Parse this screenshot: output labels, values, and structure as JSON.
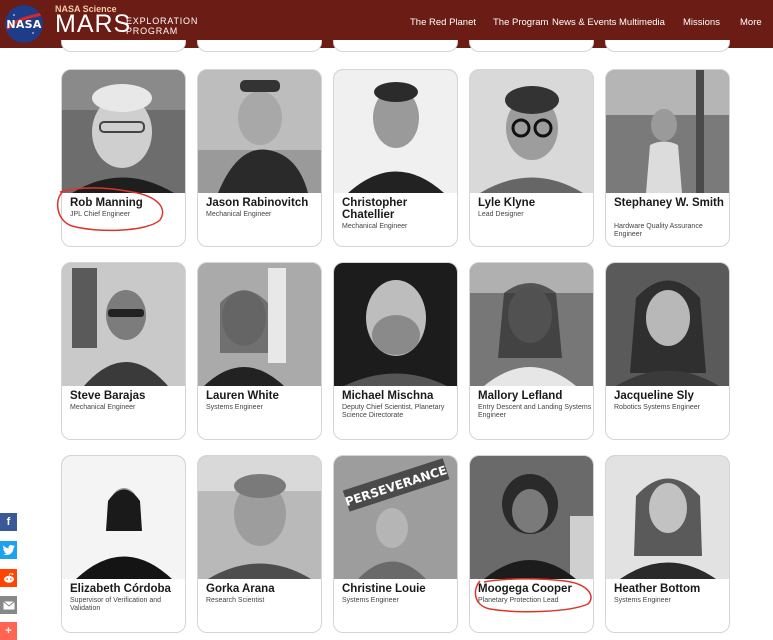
{
  "header": {
    "logo_text": "NASA",
    "kicker": "NASA Science",
    "title": "MARS",
    "subtitle_line1": "EXPLORATION",
    "subtitle_line2": "PROGRAM",
    "nav": [
      "The Red Planet",
      "The Program",
      "News & Events",
      "Multimedia",
      "Missions",
      "More"
    ]
  },
  "people": [
    {
      "name": "Rob Manning",
      "role": "JPL Chief Engineer"
    },
    {
      "name": "Jason Rabinovitch",
      "role": "Mechanical Engineer"
    },
    {
      "name": "Christopher Chatellier",
      "role": "Mechanical Engineer"
    },
    {
      "name": "Lyle Klyne",
      "role": "Lead Designer"
    },
    {
      "name": "Stephaney W. Smith",
      "role": "Hardware Quality Assurance Engineer"
    },
    {
      "name": "Steve Barajas",
      "role": "Mechanical Engineer"
    },
    {
      "name": "Lauren White",
      "role": "Systems Engineer"
    },
    {
      "name": "Michael Mischna",
      "role": "Deputy Chief Scientist, Planetary Science Directorate"
    },
    {
      "name": "Mallory Lefland",
      "role": "Entry Descent and Landing Systems Engineer"
    },
    {
      "name": "Jacqueline Sly",
      "role": "Robotics Systems Engineer"
    },
    {
      "name": "Elizabeth Córdoba",
      "role": "Supervisor of Verification and Validation"
    },
    {
      "name": "Gorka Arana",
      "role": "Research Scientist"
    },
    {
      "name": "Christine Louie",
      "role": "Systems Engineer"
    },
    {
      "name": "Moogega Cooper",
      "role": "Planetary Protection Lead"
    },
    {
      "name": "Heather Bottom",
      "role": "Systems Engineer"
    }
  ],
  "share": [
    {
      "icon": "facebook-icon",
      "glyph": "f",
      "color": "#3b5998"
    },
    {
      "icon": "twitter-icon",
      "glyph": "🐦",
      "color": "#1da1f2"
    },
    {
      "icon": "reddit-icon",
      "glyph": "●",
      "color": "#ff4500"
    },
    {
      "icon": "email-icon",
      "glyph": "✉",
      "color": "#888888"
    },
    {
      "icon": "more-share-icon",
      "glyph": "+",
      "color": "#ff6550"
    }
  ],
  "photo_text": "PERSEVERANCE",
  "colors": {
    "header": "#6b1c15",
    "annotation": "#e0332b"
  }
}
